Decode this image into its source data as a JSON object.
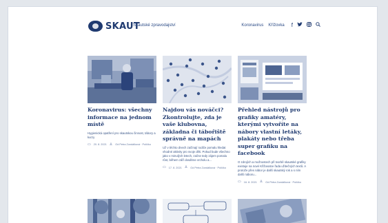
{
  "header": {
    "logo_text": "SKAUT",
    "tagline": "Skautské zpravodajství",
    "nav": [
      "Koronavirus",
      "Křížovka"
    ],
    "social_icons": [
      "facebook-icon",
      "twitter-icon",
      "instagram-icon",
      "search-icon"
    ]
  },
  "articles": [
    {
      "title": "Koronavirus: všechny informace na jednom místě",
      "excerpt": "Hygienická opatření pro skautskou činnost, tábory a kurzy",
      "date": "20. 8. 2021",
      "author": "Od Petra Zundálková · Políčko"
    },
    {
      "title": "Najdou vás nováčci? Zkontrolujte, zda je vaše klubovna, základna či tábořiště správně na mapách",
      "excerpt": "Už v těchto dnech začínají rodiče pomalu hledat vhodné aktivity pro svoje děti. Pokud bude všechno jako v minulých letech, začne tedy zájem pomalu růst, během září dosáhne vrcholu a...",
      "date": "17. 8. 2021",
      "author": "Od Petra Zundálková · Políčko"
    },
    {
      "title": "Přehled nástrojů pro grafiky amatéry, kterými vytvoříte na nábory vlastní letáky, plakáty nebo třeba super grafiku na facebook",
      "excerpt": "O zdrojích a možnostech při tvorbě skautské grafiky existuje na nové Křižovatce řada užitečných textů. A protože přes nábor je další skautský rok a s ním další náboru...",
      "date": "16. 8. 2021",
      "author": "Od Petra Zundálková · Políčko"
    }
  ]
}
